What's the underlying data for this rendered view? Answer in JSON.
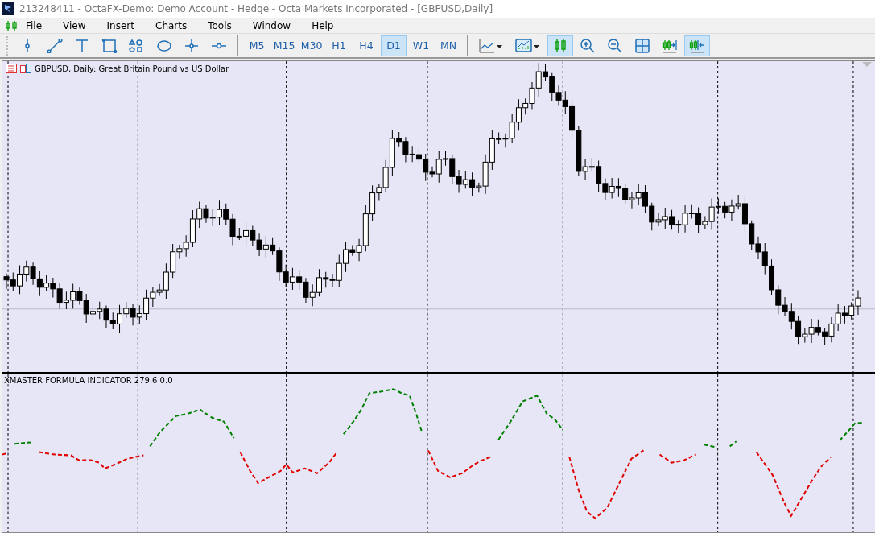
{
  "window": {
    "title": "213248411 - OctaFX-Demo: Demo Account - Hedge - Octa Markets Incorporated - [GBPUSD,Daily]"
  },
  "menu": [
    "File",
    "View",
    "Insert",
    "Charts",
    "Tools",
    "Window",
    "Help"
  ],
  "toolbar": {
    "drawing_tools": [
      {
        "kind": "vline"
      },
      {
        "kind": "trendline"
      },
      {
        "kind": "text"
      },
      {
        "kind": "rectangle"
      },
      {
        "kind": "shapes"
      },
      {
        "kind": "ellipse"
      },
      {
        "kind": "crosshair"
      },
      {
        "kind": "hline"
      }
    ],
    "timeframes": [
      {
        "label": "M5",
        "selected": false
      },
      {
        "label": "M15",
        "selected": false
      },
      {
        "label": "M30",
        "selected": false
      },
      {
        "label": "H1",
        "selected": false
      },
      {
        "label": "H4",
        "selected": false
      },
      {
        "label": "D1",
        "selected": true
      },
      {
        "label": "W1",
        "selected": false
      },
      {
        "label": "MN",
        "selected": false
      }
    ],
    "chart_tools": [
      {
        "kind": "line-chart",
        "selected": false
      },
      {
        "kind": "indicators",
        "selected": false
      },
      {
        "kind": "candles",
        "selected": true
      },
      {
        "kind": "zoom-in",
        "selected": false
      },
      {
        "kind": "zoom-out",
        "selected": false
      },
      {
        "kind": "tile",
        "selected": false
      },
      {
        "kind": "shift",
        "selected": false
      },
      {
        "kind": "autoscroll",
        "selected": true
      }
    ]
  },
  "chart": {
    "title": "GBPUSD, Daily:  Great Britain Pound vs US Dollar"
  },
  "indicator": {
    "label": "XMASTER FORMULA INDICATOR 279.6 0.0"
  }
}
